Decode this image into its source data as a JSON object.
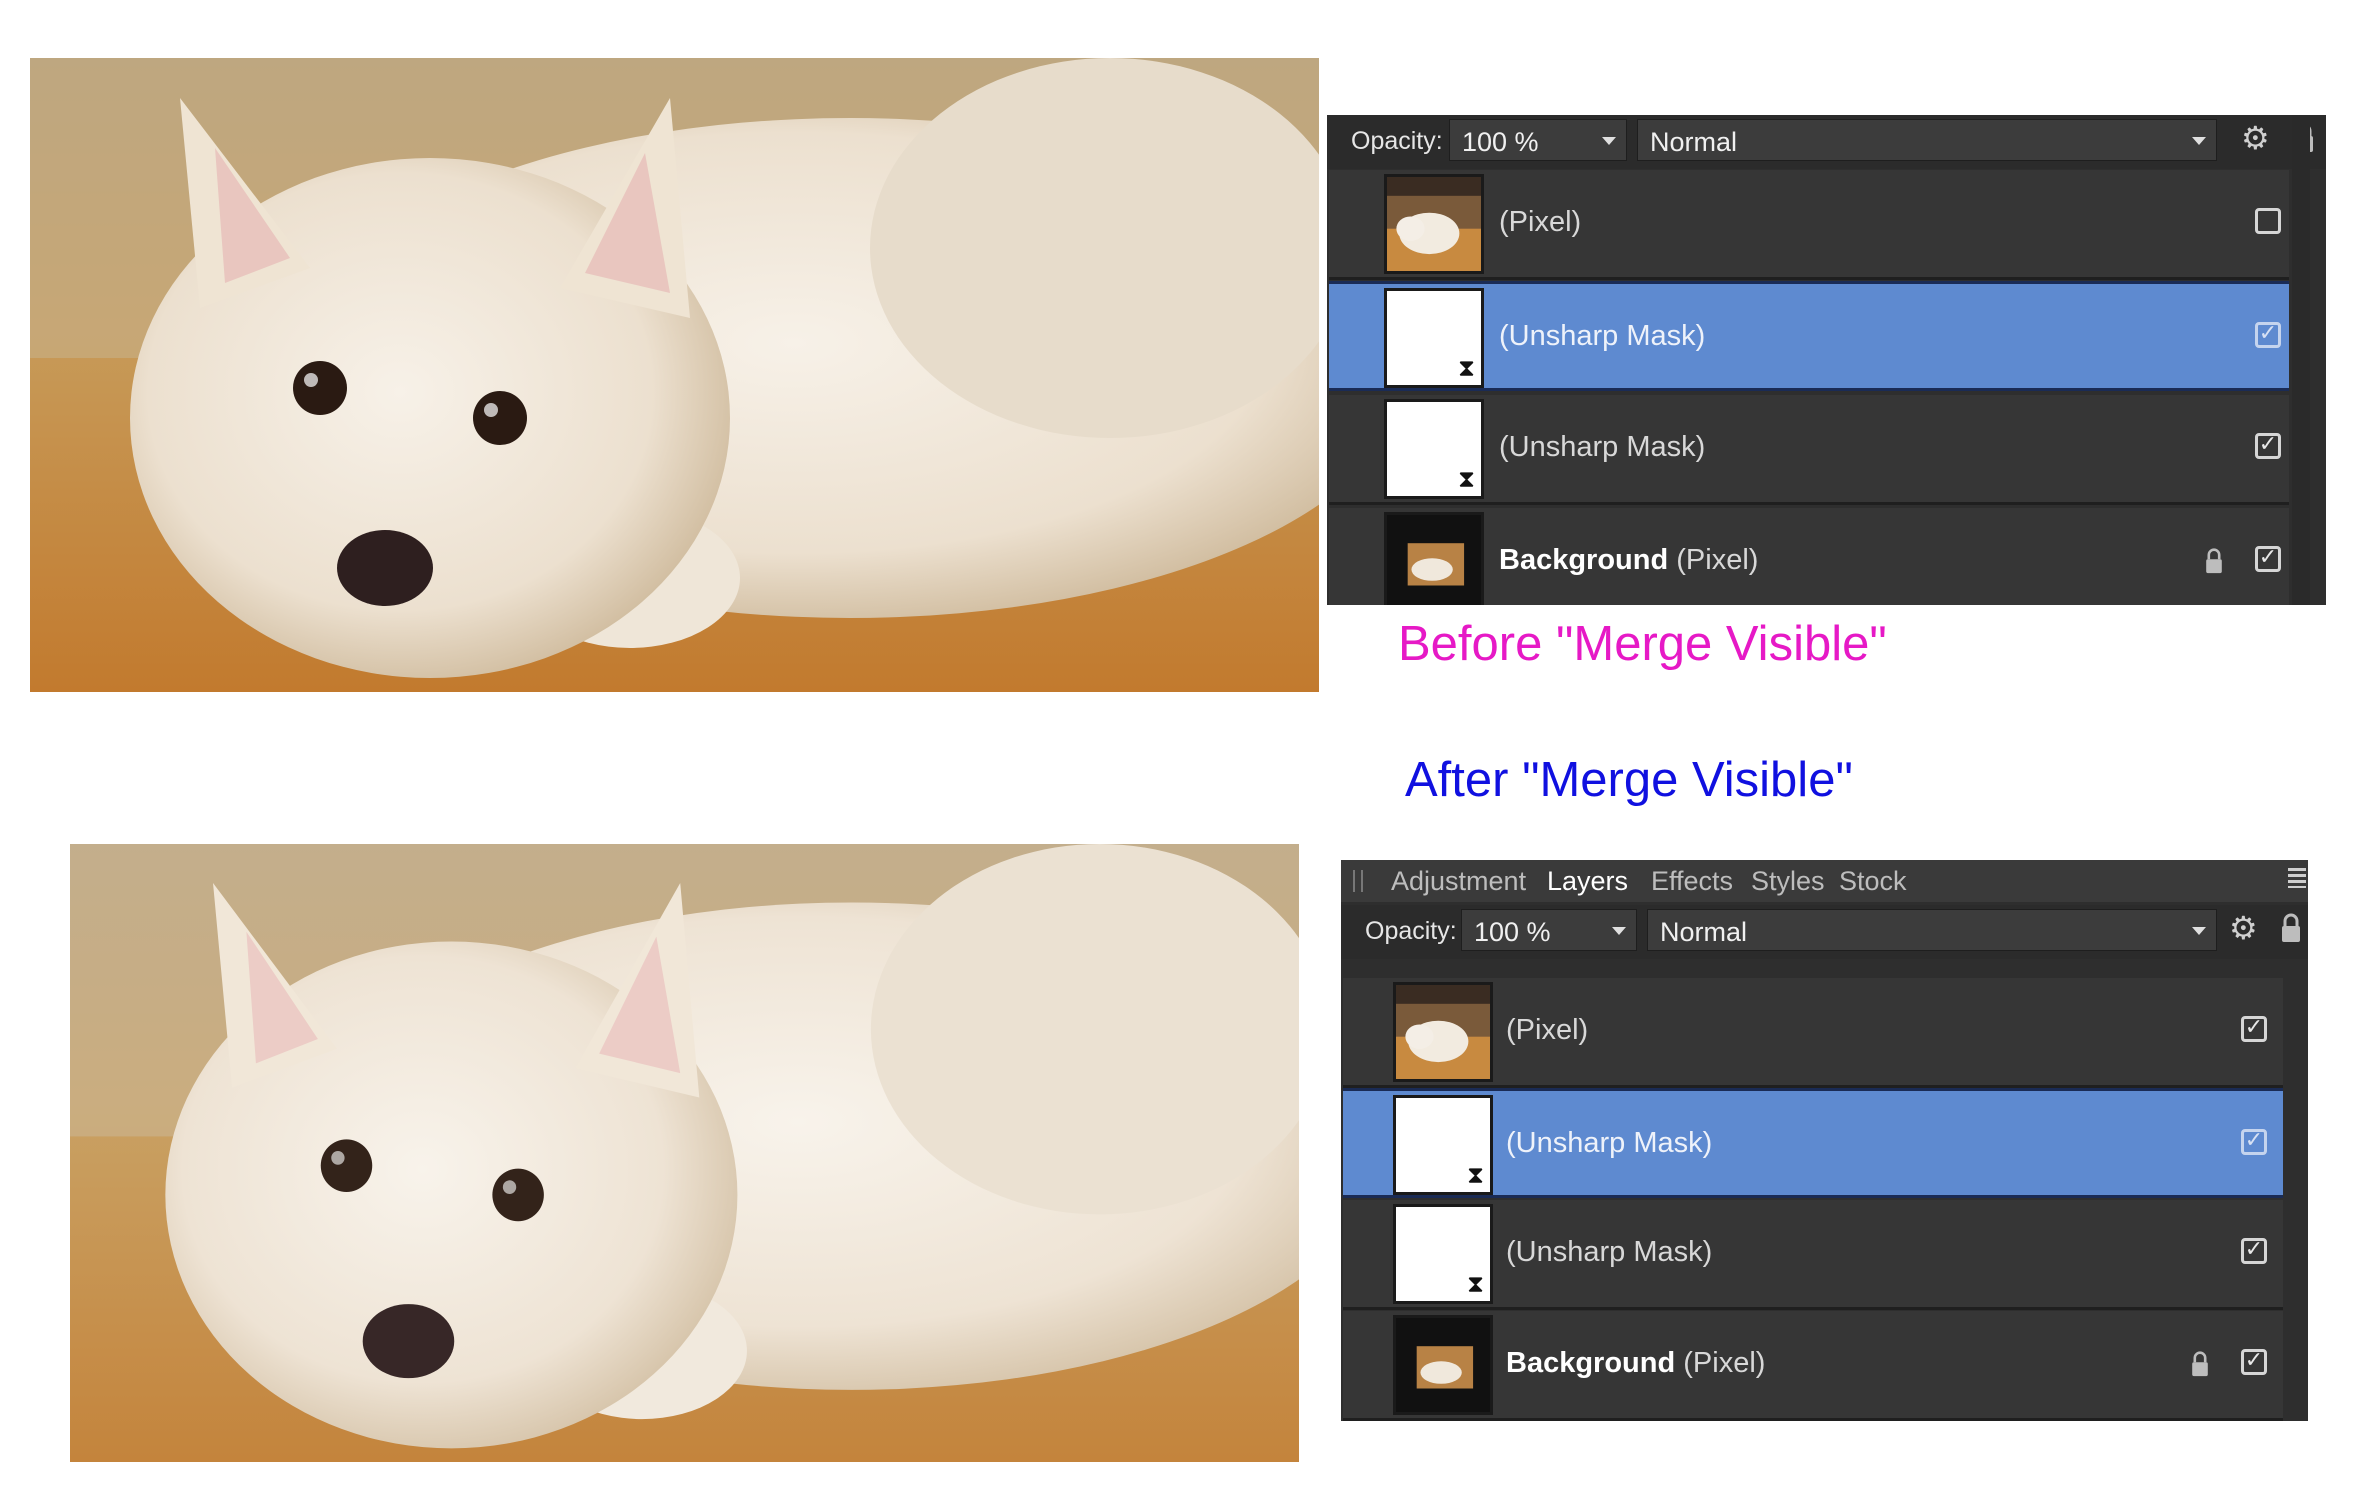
{
  "captions": {
    "before": "Before \"Merge Visible\"",
    "after": "After \"Merge Visible\""
  },
  "colors": {
    "before_caption": "#e619c6",
    "after_caption": "#1010e0",
    "selected_row": "#5e8ad0",
    "panel_bg": "#2e2e2e"
  },
  "photos": {
    "before": {
      "subject": "white spitz dog lying on orange carpet",
      "sharpness": "sharpened"
    },
    "after": {
      "subject": "white spitz dog lying on orange carpet",
      "sharpness": "soft"
    }
  },
  "panel_before": {
    "opacity_label": "Opacity:",
    "opacity_value": "100 %",
    "blend_mode": "Normal",
    "icons": [
      "gear-icon",
      "lock-icon"
    ],
    "layers": [
      {
        "name": "",
        "type": "(Pixel)",
        "thumb": "photo",
        "visible": false,
        "selected": false,
        "locked": false
      },
      {
        "name": "",
        "type": "(Unsharp Mask)",
        "thumb": "mask",
        "visible": true,
        "selected": true,
        "locked": false
      },
      {
        "name": "",
        "type": "(Unsharp Mask)",
        "thumb": "mask",
        "visible": true,
        "selected": false,
        "locked": false
      },
      {
        "name": "Background",
        "type": "(Pixel)",
        "thumb": "photo-small",
        "visible": true,
        "selected": false,
        "locked": true
      }
    ]
  },
  "panel_after": {
    "tabs": [
      "Adjustment",
      "Layers",
      "Effects",
      "Styles",
      "Stock"
    ],
    "active_tab": "Layers",
    "opacity_label": "Opacity:",
    "opacity_value": "100 %",
    "blend_mode": "Normal",
    "icons": [
      "grip-icon",
      "panel-menu-icon",
      "gear-icon",
      "lock-icon"
    ],
    "layers": [
      {
        "name": "",
        "type": "(Pixel)",
        "thumb": "photo",
        "visible": true,
        "selected": false,
        "locked": false
      },
      {
        "name": "",
        "type": "(Unsharp Mask)",
        "thumb": "mask",
        "visible": true,
        "selected": true,
        "locked": false
      },
      {
        "name": "",
        "type": "(Unsharp Mask)",
        "thumb": "mask",
        "visible": true,
        "selected": false,
        "locked": false
      },
      {
        "name": "Background",
        "type": "(Pixel)",
        "thumb": "photo-small",
        "visible": true,
        "selected": false,
        "locked": true
      }
    ]
  }
}
